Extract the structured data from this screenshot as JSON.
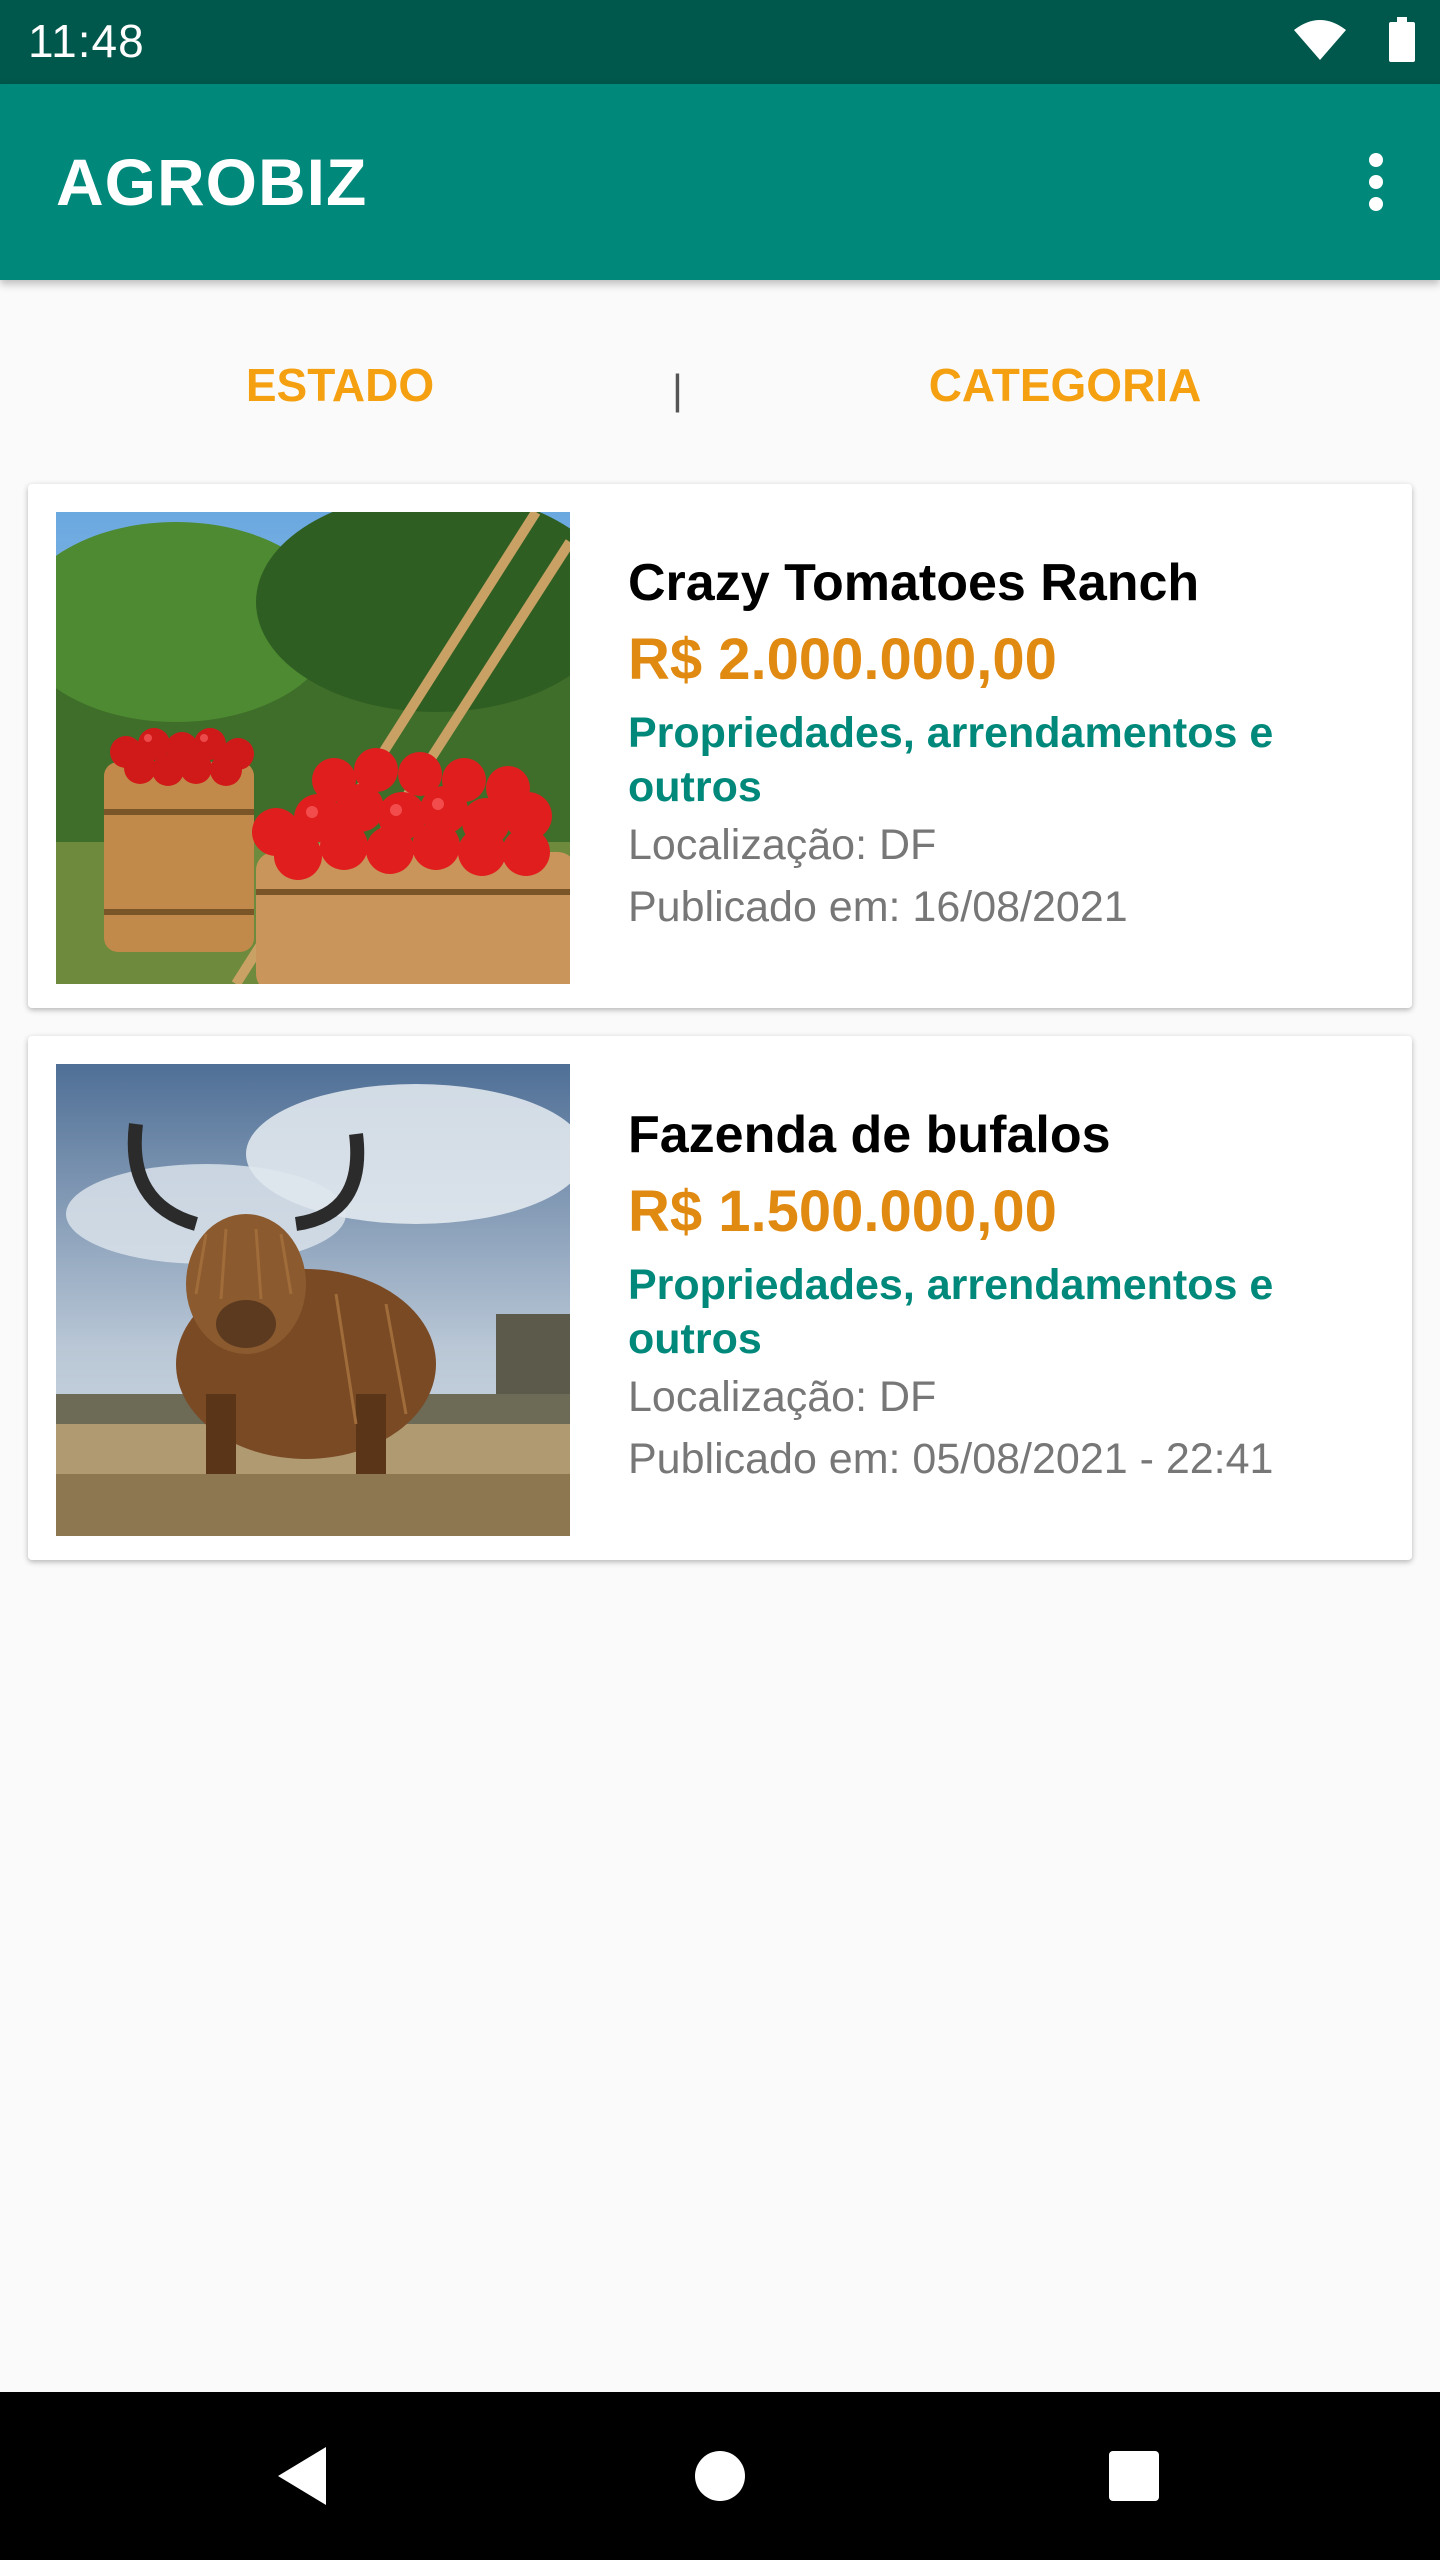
{
  "status_bar": {
    "time": "11:48"
  },
  "app_bar": {
    "title": "AGROBIZ"
  },
  "filters": {
    "estado_label": "ESTADO",
    "separator": "|",
    "categoria_label": "CATEGORIA"
  },
  "listings": [
    {
      "title": "Crazy Tomatoes Ranch",
      "price": "R$ 2.000.000,00",
      "category": "Propriedades, arrendamentos e outros",
      "location": "Localização: DF",
      "published": "Publicado em: 16/08/2021",
      "image": "apple-orchard-barrels"
    },
    {
      "title": "Fazenda de bufalos",
      "price": "R$ 1.500.000,00",
      "category": "Propriedades, arrendamentos e outros",
      "location": "Localização: DF",
      "published": "Publicado em: 05/08/2021 - 22:41",
      "image": "highland-bull-in-field"
    }
  ],
  "colors": {
    "status_bar": "#00574b",
    "app_bar": "#00897b",
    "filter_text": "#f5a011",
    "price": "#e08a12",
    "category": "#00897b"
  },
  "icons": {
    "wifi": "wifi-icon",
    "battery": "battery-icon",
    "overflow": "more-vert-icon",
    "back": "nav-back-icon",
    "home": "nav-home-icon",
    "recent": "nav-recent-icon"
  }
}
